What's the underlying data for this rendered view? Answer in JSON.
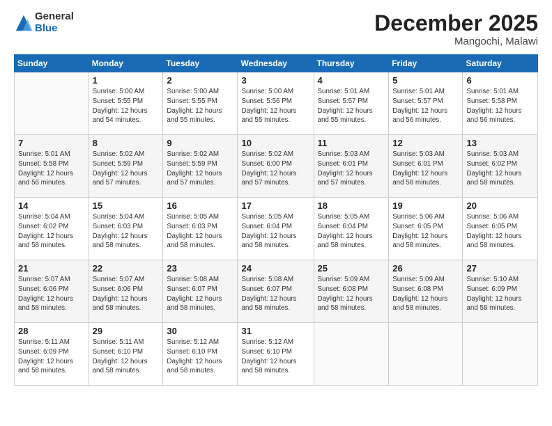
{
  "logo": {
    "general": "General",
    "blue": "Blue"
  },
  "title": "December 2025",
  "location": "Mangochi, Malawi",
  "days_of_week": [
    "Sunday",
    "Monday",
    "Tuesday",
    "Wednesday",
    "Thursday",
    "Friday",
    "Saturday"
  ],
  "weeks": [
    [
      {
        "day": "",
        "info": ""
      },
      {
        "day": "1",
        "info": "Sunrise: 5:00 AM\nSunset: 5:55 PM\nDaylight: 12 hours\nand 54 minutes."
      },
      {
        "day": "2",
        "info": "Sunrise: 5:00 AM\nSunset: 5:55 PM\nDaylight: 12 hours\nand 55 minutes."
      },
      {
        "day": "3",
        "info": "Sunrise: 5:00 AM\nSunset: 5:56 PM\nDaylight: 12 hours\nand 55 minutes."
      },
      {
        "day": "4",
        "info": "Sunrise: 5:01 AM\nSunset: 5:57 PM\nDaylight: 12 hours\nand 55 minutes."
      },
      {
        "day": "5",
        "info": "Sunrise: 5:01 AM\nSunset: 5:57 PM\nDaylight: 12 hours\nand 56 minutes."
      },
      {
        "day": "6",
        "info": "Sunrise: 5:01 AM\nSunset: 5:58 PM\nDaylight: 12 hours\nand 56 minutes."
      }
    ],
    [
      {
        "day": "7",
        "info": "Sunrise: 5:01 AM\nSunset: 5:58 PM\nDaylight: 12 hours\nand 56 minutes."
      },
      {
        "day": "8",
        "info": "Sunrise: 5:02 AM\nSunset: 5:59 PM\nDaylight: 12 hours\nand 57 minutes."
      },
      {
        "day": "9",
        "info": "Sunrise: 5:02 AM\nSunset: 5:59 PM\nDaylight: 12 hours\nand 57 minutes."
      },
      {
        "day": "10",
        "info": "Sunrise: 5:02 AM\nSunset: 6:00 PM\nDaylight: 12 hours\nand 57 minutes."
      },
      {
        "day": "11",
        "info": "Sunrise: 5:03 AM\nSunset: 6:01 PM\nDaylight: 12 hours\nand 57 minutes."
      },
      {
        "day": "12",
        "info": "Sunrise: 5:03 AM\nSunset: 6:01 PM\nDaylight: 12 hours\nand 58 minutes."
      },
      {
        "day": "13",
        "info": "Sunrise: 5:03 AM\nSunset: 6:02 PM\nDaylight: 12 hours\nand 58 minutes."
      }
    ],
    [
      {
        "day": "14",
        "info": "Sunrise: 5:04 AM\nSunset: 6:02 PM\nDaylight: 12 hours\nand 58 minutes."
      },
      {
        "day": "15",
        "info": "Sunrise: 5:04 AM\nSunset: 6:03 PM\nDaylight: 12 hours\nand 58 minutes."
      },
      {
        "day": "16",
        "info": "Sunrise: 5:05 AM\nSunset: 6:03 PM\nDaylight: 12 hours\nand 58 minutes."
      },
      {
        "day": "17",
        "info": "Sunrise: 5:05 AM\nSunset: 6:04 PM\nDaylight: 12 hours\nand 58 minutes."
      },
      {
        "day": "18",
        "info": "Sunrise: 5:05 AM\nSunset: 6:04 PM\nDaylight: 12 hours\nand 58 minutes."
      },
      {
        "day": "19",
        "info": "Sunrise: 5:06 AM\nSunset: 6:05 PM\nDaylight: 12 hours\nand 58 minutes."
      },
      {
        "day": "20",
        "info": "Sunrise: 5:06 AM\nSunset: 6:05 PM\nDaylight: 12 hours\nand 58 minutes."
      }
    ],
    [
      {
        "day": "21",
        "info": "Sunrise: 5:07 AM\nSunset: 6:06 PM\nDaylight: 12 hours\nand 58 minutes."
      },
      {
        "day": "22",
        "info": "Sunrise: 5:07 AM\nSunset: 6:06 PM\nDaylight: 12 hours\nand 58 minutes."
      },
      {
        "day": "23",
        "info": "Sunrise: 5:08 AM\nSunset: 6:07 PM\nDaylight: 12 hours\nand 58 minutes."
      },
      {
        "day": "24",
        "info": "Sunrise: 5:08 AM\nSunset: 6:07 PM\nDaylight: 12 hours\nand 58 minutes."
      },
      {
        "day": "25",
        "info": "Sunrise: 5:09 AM\nSunset: 6:08 PM\nDaylight: 12 hours\nand 58 minutes."
      },
      {
        "day": "26",
        "info": "Sunrise: 5:09 AM\nSunset: 6:08 PM\nDaylight: 12 hours\nand 58 minutes."
      },
      {
        "day": "27",
        "info": "Sunrise: 5:10 AM\nSunset: 6:09 PM\nDaylight: 12 hours\nand 58 minutes."
      }
    ],
    [
      {
        "day": "28",
        "info": "Sunrise: 5:11 AM\nSunset: 6:09 PM\nDaylight: 12 hours\nand 58 minutes."
      },
      {
        "day": "29",
        "info": "Sunrise: 5:11 AM\nSunset: 6:10 PM\nDaylight: 12 hours\nand 58 minutes."
      },
      {
        "day": "30",
        "info": "Sunrise: 5:12 AM\nSunset: 6:10 PM\nDaylight: 12 hours\nand 58 minutes."
      },
      {
        "day": "31",
        "info": "Sunrise: 5:12 AM\nSunset: 6:10 PM\nDaylight: 12 hours\nand 58 minutes."
      },
      {
        "day": "",
        "info": ""
      },
      {
        "day": "",
        "info": ""
      },
      {
        "day": "",
        "info": ""
      }
    ]
  ]
}
